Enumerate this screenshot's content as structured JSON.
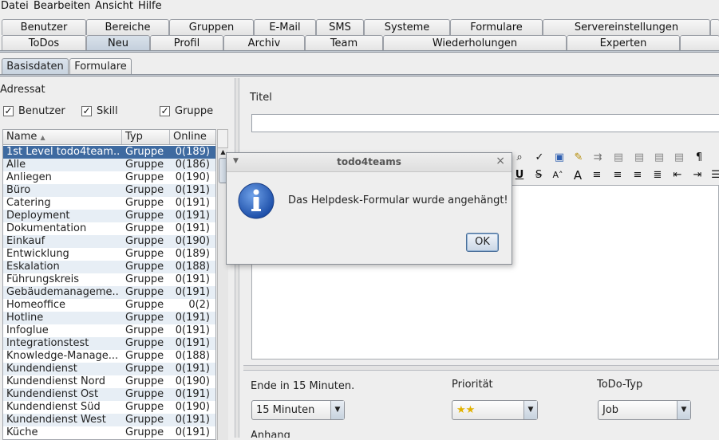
{
  "menu": [
    "Datei",
    "Bearbeiten",
    "Ansicht",
    "Hilfe"
  ],
  "tabs_row1": [
    "Benutzer",
    "Bereiche",
    "Gruppen",
    "E-Mail",
    "SMS",
    "Systeme",
    "Formulare",
    "Servereinstellungen"
  ],
  "tabs_row2": [
    "ToDos",
    "Neu",
    "Profil",
    "Archiv",
    "Team",
    "Wiederholungen",
    "Experten"
  ],
  "subtabs": [
    "Basisdaten",
    "Formulare"
  ],
  "left": {
    "adressat_label": "Adressat",
    "checkboxes": [
      {
        "label": "Benutzer",
        "checked": "✓"
      },
      {
        "label": "Skill",
        "checked": "✓"
      },
      {
        "label": "Gruppe",
        "checked": "✓"
      }
    ],
    "columns": [
      "Name",
      "Typ",
      "Online"
    ],
    "rows": [
      {
        "name": "1st Level todo4team...",
        "typ": "Gruppe",
        "online": "0(189)"
      },
      {
        "name": "Alle",
        "typ": "Gruppe",
        "online": "0(186)"
      },
      {
        "name": "Anliegen",
        "typ": "Gruppe",
        "online": "0(190)"
      },
      {
        "name": "Büro",
        "typ": "Gruppe",
        "online": "0(191)"
      },
      {
        "name": "Catering",
        "typ": "Gruppe",
        "online": "0(191)"
      },
      {
        "name": "Deployment",
        "typ": "Gruppe",
        "online": "0(191)"
      },
      {
        "name": "Dokumentation",
        "typ": "Gruppe",
        "online": "0(191)"
      },
      {
        "name": "Einkauf",
        "typ": "Gruppe",
        "online": "0(190)"
      },
      {
        "name": "Entwicklung",
        "typ": "Gruppe",
        "online": "0(189)"
      },
      {
        "name": "Eskalation",
        "typ": "Gruppe",
        "online": "0(188)"
      },
      {
        "name": "Führungskreis",
        "typ": "Gruppe",
        "online": "0(191)"
      },
      {
        "name": "Gebäudemanageme...",
        "typ": "Gruppe",
        "online": "0(191)"
      },
      {
        "name": "Homeoffice",
        "typ": "Gruppe",
        "online": "0(2)"
      },
      {
        "name": "Hotline",
        "typ": "Gruppe",
        "online": "0(191)"
      },
      {
        "name": "Infoglue",
        "typ": "Gruppe",
        "online": "0(191)"
      },
      {
        "name": "Integrationstest",
        "typ": "Gruppe",
        "online": "0(191)"
      },
      {
        "name": "Knowledge-Manage...",
        "typ": "Gruppe",
        "online": "0(188)"
      },
      {
        "name": "Kundendienst",
        "typ": "Gruppe",
        "online": "0(191)"
      },
      {
        "name": "Kundendienst Nord",
        "typ": "Gruppe",
        "online": "0(190)"
      },
      {
        "name": "Kundendienst Ost",
        "typ": "Gruppe",
        "online": "0(191)"
      },
      {
        "name": "Kundendienst Süd",
        "typ": "Gruppe",
        "online": "0(190)"
      },
      {
        "name": "Kundendienst West",
        "typ": "Gruppe",
        "online": "0(191)"
      },
      {
        "name": "Küche",
        "typ": "Gruppe",
        "online": "0(191)"
      }
    ]
  },
  "right": {
    "titel_label": "Titel",
    "titel_value": "",
    "ende_label": "Ende in 15 Minuten.",
    "ende_value": "15 Minuten",
    "prioritaet_label": "Priorität",
    "prioritaet_value": "★★",
    "todotyp_label": "ToDo-Typ",
    "todotyp_value": "Job",
    "anhang_label": "Anhang"
  },
  "dialog": {
    "title": "todo4teams",
    "message": "Das Helpdesk-Formular wurde angehängt!",
    "ok_label": "OK",
    "icon": "info-icon"
  },
  "colors": {
    "selection": "#3e6aa0",
    "accent": "#2f5fb0"
  }
}
